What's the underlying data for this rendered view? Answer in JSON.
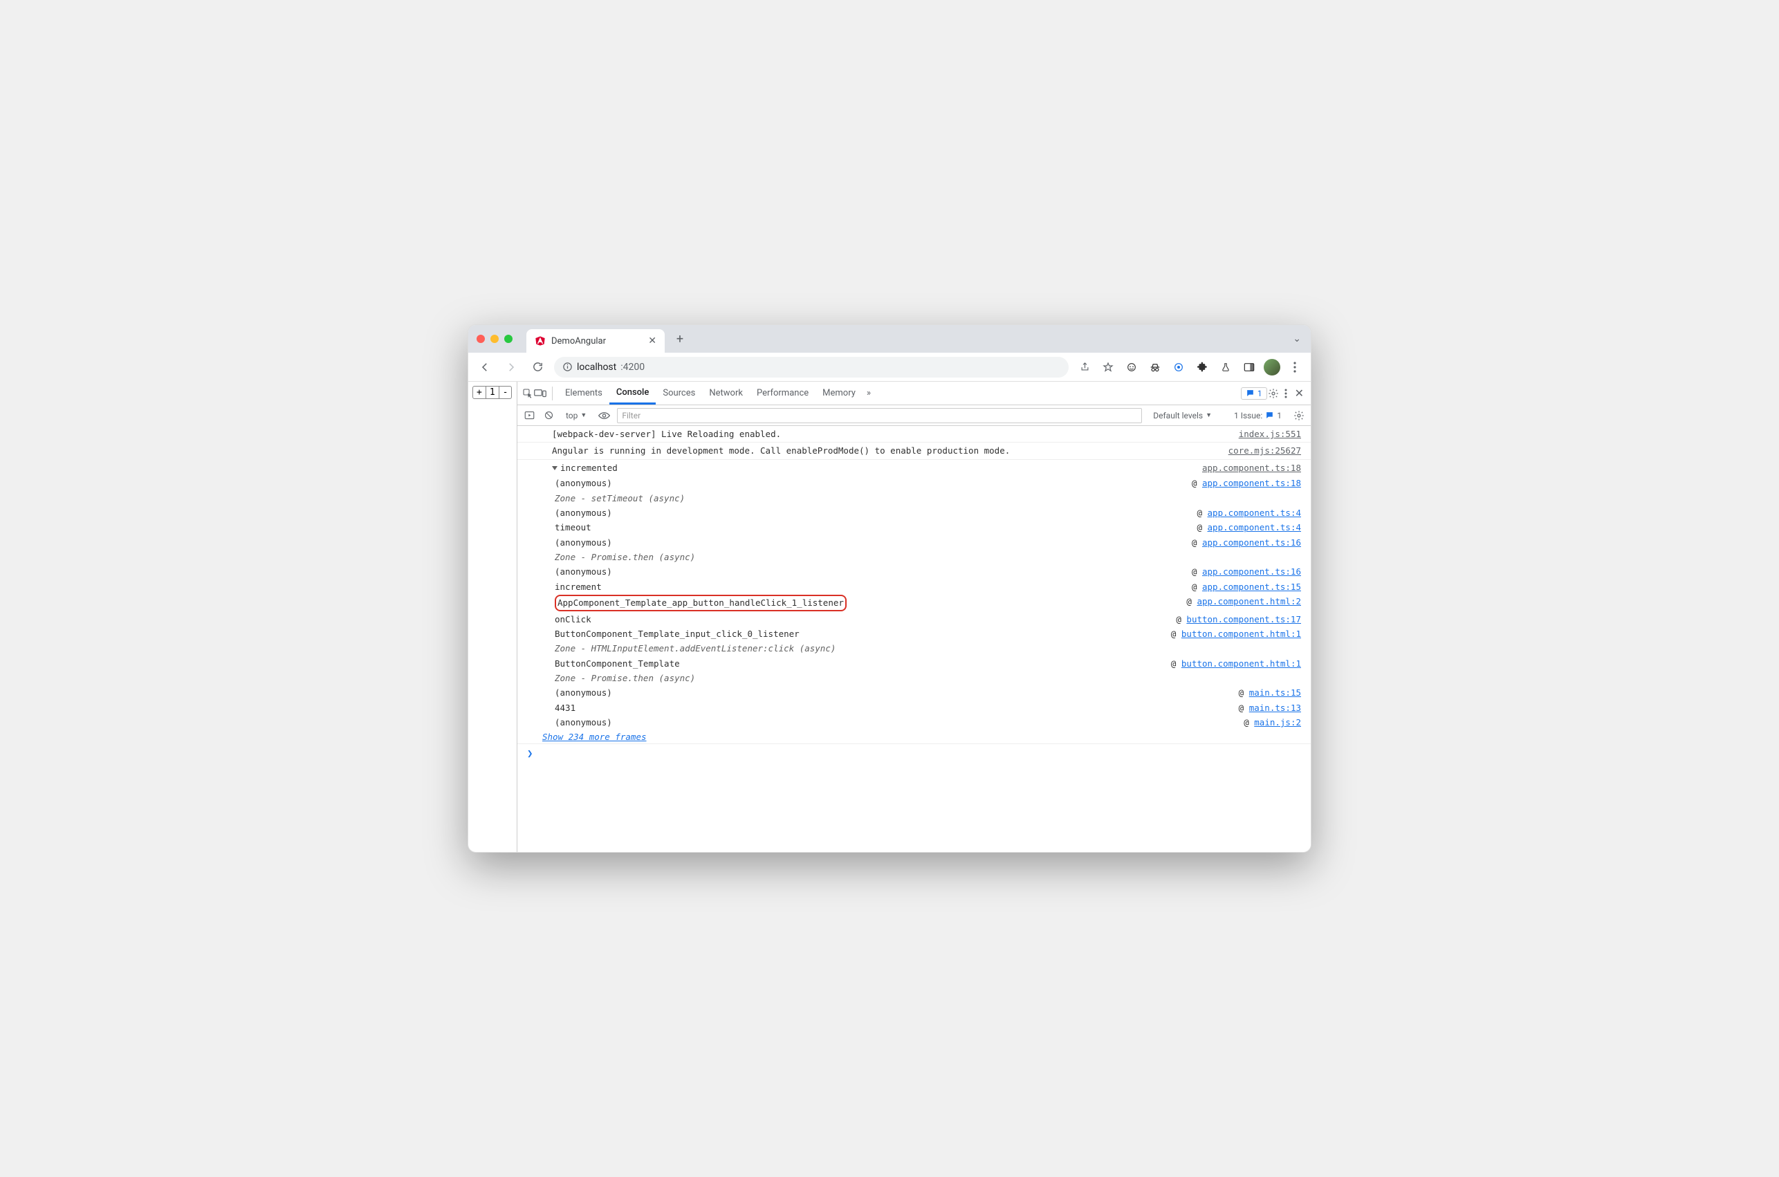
{
  "browser": {
    "tab_title": "DemoAngular",
    "url_host": "localhost",
    "url_port": ":4200"
  },
  "page_controls": {
    "plus": "+",
    "val": "1",
    "minus": "-"
  },
  "devtools": {
    "tabs": [
      "Elements",
      "Console",
      "Sources",
      "Network",
      "Performance",
      "Memory"
    ],
    "active_tab": "Console",
    "badge_count": "1",
    "issues_label": "1 Issue:",
    "issues_count": "1"
  },
  "console_toolbar": {
    "context": "top",
    "filter_placeholder": "Filter",
    "levels": "Default levels"
  },
  "console": {
    "m1": {
      "text": "[webpack-dev-server] Live Reloading enabled.",
      "src": "index.js:551"
    },
    "m2": {
      "text": "Angular is running in development mode. Call enableProdMode() to enable production mode.",
      "src": "core.mjs:25627"
    },
    "trace_header": "incremented",
    "trace_src": "app.component.ts:18",
    "stack": [
      {
        "name": "(anonymous)",
        "link": "app.component.ts:18",
        "type": "link"
      },
      {
        "name": "Zone - setTimeout (async)",
        "type": "zone"
      },
      {
        "name": "(anonymous)",
        "link": "app.component.ts:4",
        "type": "link"
      },
      {
        "name": "timeout",
        "link": "app.component.ts:4",
        "type": "link"
      },
      {
        "name": "(anonymous)",
        "link": "app.component.ts:16",
        "type": "link"
      },
      {
        "name": "Zone - Promise.then (async)",
        "type": "zone"
      },
      {
        "name": "(anonymous)",
        "link": "app.component.ts:16",
        "type": "link"
      },
      {
        "name": "increment",
        "link": "app.component.ts:15",
        "type": "link"
      },
      {
        "name": "AppComponent_Template_app_button_handleClick_1_listener",
        "link": "app.component.html:2",
        "type": "link",
        "highlight": true
      },
      {
        "name": "onClick",
        "link": "button.component.ts:17",
        "type": "link"
      },
      {
        "name": "ButtonComponent_Template_input_click_0_listener",
        "link": "button.component.html:1",
        "type": "link"
      },
      {
        "name": "Zone - HTMLInputElement.addEventListener:click (async)",
        "type": "zone"
      },
      {
        "name": "ButtonComponent_Template",
        "link": "button.component.html:1",
        "type": "link"
      },
      {
        "name": "Zone - Promise.then (async)",
        "type": "zone"
      },
      {
        "name": "(anonymous)",
        "link": "main.ts:15",
        "type": "link"
      },
      {
        "name": "4431",
        "link": "main.ts:13",
        "type": "link"
      },
      {
        "name": "(anonymous)",
        "link": "main.js:2",
        "type": "link"
      }
    ],
    "more": "Show 234 more frames"
  }
}
